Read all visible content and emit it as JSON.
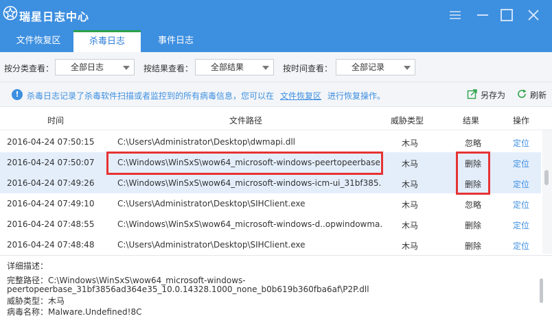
{
  "app": {
    "title": "瑞星日志中心",
    "accent": "#3d8fe0",
    "tab_accent": "#2ca24a"
  },
  "window_controls": [
    "menu-icon",
    "minimize-icon",
    "maximize-icon",
    "close-icon"
  ],
  "tabs": [
    {
      "label": "文件恢复区",
      "active": false
    },
    {
      "label": "杀毒日志",
      "active": true
    },
    {
      "label": "事件日志",
      "active": false
    }
  ],
  "filters": {
    "category_label": "按分类查看：",
    "category_value": "全部日志",
    "result_label": "按结果查看：",
    "result_value": "全部结果",
    "time_label": "按时间查看：",
    "time_value": "全部记录"
  },
  "info": {
    "text": "杀毒日志记录了杀毒软件扫描或者监控到的所有病毒信息，您可以在",
    "link": "文件恢复区",
    "after": "进行恢复操作。",
    "save_as": "另存为",
    "refresh": "刷新"
  },
  "table": {
    "headers": {
      "time": "时间",
      "path": "文件路径",
      "threat": "威胁类型",
      "result": "结果",
      "action": "操作"
    },
    "rows": [
      {
        "time": "2016-04-24 07:50:15",
        "path": "C:\\Users\\Administrator\\Desktop\\dwmapi.dll",
        "threat": "木马",
        "result": "忽略",
        "action": "定位"
      },
      {
        "time": "2016-04-24 07:50:07",
        "path": "C:\\Windows\\WinSxS\\wow64_microsoft-windows-peertopeerbase...",
        "threat": "木马",
        "result": "删除",
        "action": "定位"
      },
      {
        "time": "2016-04-24 07:49:26",
        "path": "C:\\Windows\\WinSxS\\wow64_microsoft-windows-icm-ui_31bf385...",
        "threat": "木马",
        "result": "删除",
        "action": "定位"
      },
      {
        "time": "2016-04-24 07:49:10",
        "path": "C:\\Users\\Administrator\\Desktop\\SIHClient.exe",
        "threat": "木马",
        "result": "忽略",
        "action": "定位"
      },
      {
        "time": "2016-04-24 07:48:55",
        "path": "C:\\Windows\\WinSxS\\wow64_microsoft-windows-d..opwindowma...",
        "threat": "木马",
        "result": "删除",
        "action": "定位"
      },
      {
        "time": "2016-04-24 07:48:48",
        "path": "C:\\Users\\Administrator\\Desktop\\SIHClient.exe",
        "threat": "木马",
        "result": "删除",
        "action": "定位"
      }
    ]
  },
  "detail": {
    "heading": "详细描述：",
    "path_line1": "完整路径：C:\\Windows\\WinSxS\\wow64_microsoft-windows-",
    "path_line2": "peertopeerbase_31bf3856ad364e35_10.0.14328.1000_none_b0b619b360fba6af\\P2P.dll",
    "threat_line": "威胁类型：木马",
    "virus_line": "病毒名称：Malware.Undefined!8C"
  }
}
